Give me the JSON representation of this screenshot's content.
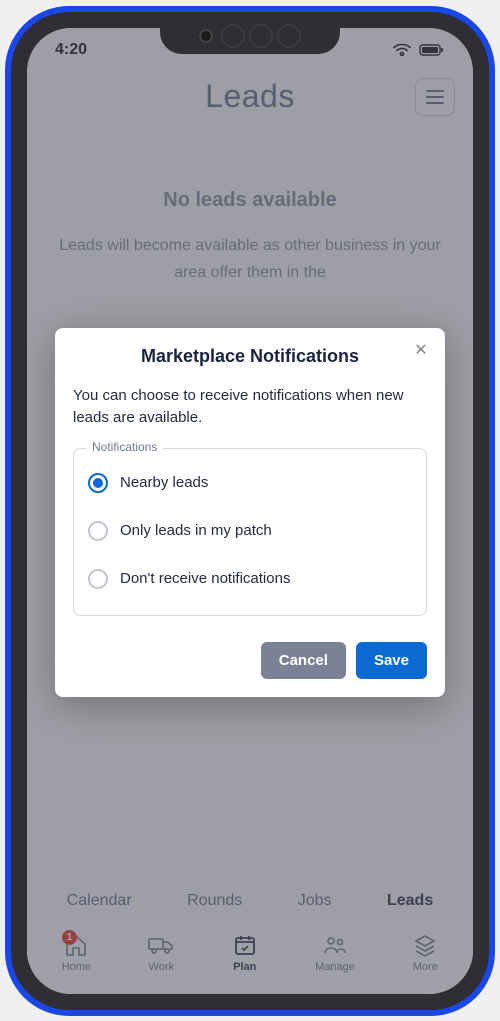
{
  "status": {
    "time": "4:20"
  },
  "header": {
    "title": "Leads"
  },
  "empty": {
    "heading": "No leads available",
    "description": "Leads will become available as other business in your area offer them in the"
  },
  "modal": {
    "title": "Marketplace Notifications",
    "description": "You can choose to receive notifications when new leads are available.",
    "legend": "Notifications",
    "options": [
      {
        "label": "Nearby leads",
        "selected": true
      },
      {
        "label": "Only leads in my patch",
        "selected": false
      },
      {
        "label": "Don't receive notifications",
        "selected": false
      }
    ],
    "cancel": "Cancel",
    "save": "Save"
  },
  "tabs": [
    {
      "label": "Calendar",
      "active": false
    },
    {
      "label": "Rounds",
      "active": false
    },
    {
      "label": "Jobs",
      "active": false
    },
    {
      "label": "Leads",
      "active": true
    }
  ],
  "nav": [
    {
      "label": "Home",
      "icon": "home-icon",
      "badge": "1"
    },
    {
      "label": "Work",
      "icon": "truck-icon"
    },
    {
      "label": "Plan",
      "icon": "calendar-icon",
      "active": true
    },
    {
      "label": "Manage",
      "icon": "people-icon"
    },
    {
      "label": "More",
      "icon": "layers-icon"
    }
  ]
}
